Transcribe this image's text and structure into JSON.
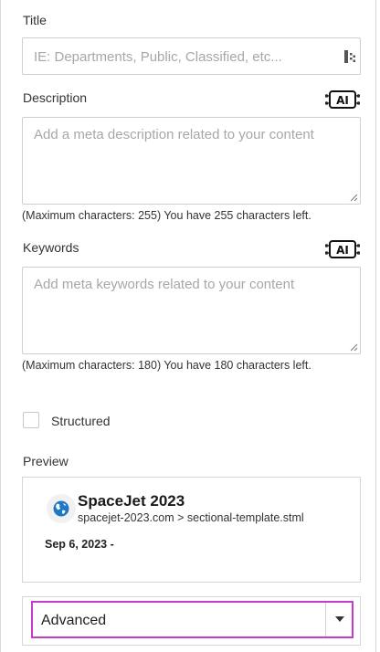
{
  "title_section": {
    "label": "Title",
    "placeholder": "IE: Departments, Public, Classified, etc..."
  },
  "description_section": {
    "label": "Description",
    "placeholder": "Add a meta description related to your content",
    "hint": "(Maximum characters: 255) You have 255 characters left."
  },
  "keywords_section": {
    "label": "Keywords",
    "placeholder": "Add meta keywords related to your content",
    "hint": "(Maximum characters: 180) You have 180 characters left."
  },
  "ai_button": {
    "text": "AI"
  },
  "structured": {
    "label": "Structured",
    "checked": false
  },
  "preview": {
    "label": "Preview",
    "site_title": "SpaceJet 2023",
    "breadcrumb": "spacejet-2023.com > sectional-template.stml",
    "date": "Sep 6, 2023 -"
  },
  "advanced_select": {
    "value": "Advanced"
  },
  "colors": {
    "accent_border": "#c43cc7",
    "globe_blue": "#1e78c8"
  }
}
